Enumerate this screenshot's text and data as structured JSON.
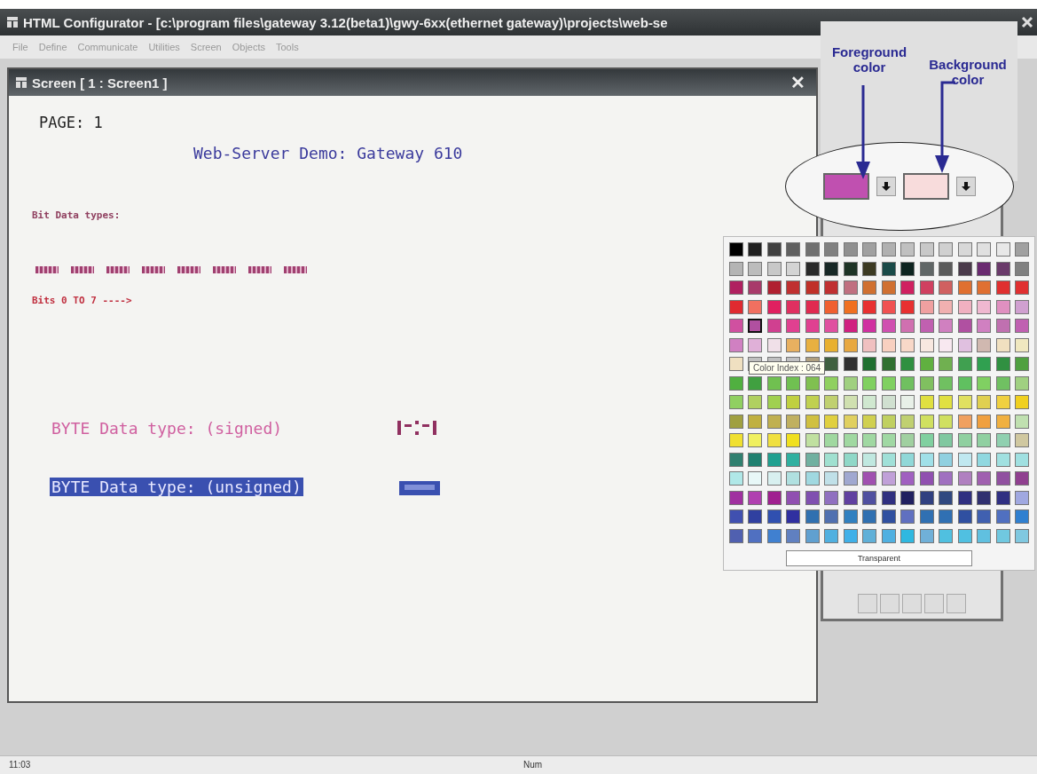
{
  "app_window": {
    "title": "HTML Configurator - [c:\\program files\\gateway 3.12(beta1)\\gwy-6xx(ethernet gateway)\\projects\\web-se"
  },
  "menu": [
    {
      "label": "File"
    },
    {
      "label": "Define"
    },
    {
      "label": "Communicate"
    },
    {
      "label": "Utilities"
    },
    {
      "label": "Screen"
    },
    {
      "label": "Objects"
    },
    {
      "label": "Tools"
    }
  ],
  "screen_window": {
    "title": "Screen [ 1 : Screen1 ]",
    "close": "✕"
  },
  "screen_objects": [
    {
      "kind": "text",
      "text": "PAGE: 1"
    },
    {
      "kind": "text",
      "text": "Web-Server Demo: Gateway 610"
    },
    {
      "kind": "text",
      "text": "Bit Data types:"
    },
    {
      "kind": "bits",
      "items": [
        {
          "kind": "bit"
        },
        {
          "kind": "bit"
        },
        {
          "kind": "bit"
        },
        {
          "kind": "bit"
        },
        {
          "kind": "bit"
        },
        {
          "kind": "bit"
        },
        {
          "kind": "bit"
        },
        {
          "kind": "bit"
        }
      ]
    },
    {
      "kind": "text",
      "text": "Bits 0 TO 7 ---->"
    },
    {
      "kind": "text",
      "text": "BYTE Data type: (signed)",
      "selected": false
    },
    {
      "kind": "value",
      "selected": false
    },
    {
      "kind": "text",
      "text": "BYTE Data type: (unsigned)",
      "selected": true
    },
    {
      "kind": "value",
      "selected": true
    }
  ],
  "palette": {
    "tooltip": "Color Index : 064",
    "transparent_button": "Transparent",
    "rows": [
      [
        {
          "color": "#000000",
          "selected": false
        },
        {
          "color": "#202020",
          "selected": false
        },
        {
          "color": "#404040",
          "selected": false
        },
        {
          "color": "#606060",
          "selected": false
        },
        {
          "color": "#707070",
          "selected": false
        },
        {
          "color": "#808080",
          "selected": false
        },
        {
          "color": "#909090",
          "selected": false
        },
        {
          "color": "#a0a0a0",
          "selected": false
        },
        {
          "color": "#b0b0b0",
          "selected": false
        },
        {
          "color": "#c0c0c0",
          "selected": false
        },
        {
          "color": "#c8c8c8",
          "selected": false
        },
        {
          "color": "#d0d0d0",
          "selected": false
        },
        {
          "color": "#d8d8d8",
          "selected": false
        },
        {
          "color": "#e0e0e0",
          "selected": false
        },
        {
          "color": "#e8e8e8",
          "selected": false
        },
        {
          "color": "#a0a0a0",
          "selected": false
        }
      ],
      [
        {
          "color": "#b4b4b4",
          "selected": false
        },
        {
          "color": "#bcbcbc",
          "selected": false
        },
        {
          "color": "#c8c8c8",
          "selected": false
        },
        {
          "color": "#d4d4d4",
          "selected": false
        },
        {
          "color": "#2a2a2a",
          "selected": false
        },
        {
          "color": "#182826",
          "selected": false
        },
        {
          "color": "#1e3426",
          "selected": false
        },
        {
          "color": "#3c3a22",
          "selected": false
        },
        {
          "color": "#1a4a48",
          "selected": false
        },
        {
          "color": "#0e2420",
          "selected": false
        },
        {
          "color": "#606666",
          "selected": false
        },
        {
          "color": "#5a5a5a",
          "selected": false
        },
        {
          "color": "#4a3a4a",
          "selected": false
        },
        {
          "color": "#6a2a70",
          "selected": false
        },
        {
          "color": "#6a3a6a",
          "selected": false
        },
        {
          "color": "#808080",
          "selected": false
        }
      ],
      [
        {
          "color": "#b02060",
          "selected": false
        },
        {
          "color": "#a83a6a",
          "selected": false
        },
        {
          "color": "#b02030",
          "selected": false
        },
        {
          "color": "#c03030",
          "selected": false
        },
        {
          "color": "#c03028",
          "selected": false
        },
        {
          "color": "#c03031",
          "selected": false
        },
        {
          "color": "#c07080",
          "selected": false
        },
        {
          "color": "#d07030",
          "selected": false
        },
        {
          "color": "#d07031",
          "selected": false
        },
        {
          "color": "#d02060",
          "selected": false
        },
        {
          "color": "#d04060",
          "selected": false
        },
        {
          "color": "#d06060",
          "selected": false
        },
        {
          "color": "#e07030",
          "selected": false
        },
        {
          "color": "#e07031",
          "selected": false
        },
        {
          "color": "#e03030",
          "selected": false
        },
        {
          "color": "#e03031",
          "selected": false
        }
      ],
      [
        {
          "color": "#e02a30",
          "selected": false
        },
        {
          "color": "#f07060",
          "selected": false
        },
        {
          "color": "#e02060",
          "selected": false
        },
        {
          "color": "#e03060",
          "selected": false
        },
        {
          "color": "#e02a50",
          "selected": false
        },
        {
          "color": "#f06030",
          "selected": false
        },
        {
          "color": "#f07020",
          "selected": false
        },
        {
          "color": "#e83030",
          "selected": false
        },
        {
          "color": "#f05050",
          "selected": false
        },
        {
          "color": "#e83031",
          "selected": false
        },
        {
          "color": "#f0a0a0",
          "selected": false
        },
        {
          "color": "#f0b0b0",
          "selected": false
        },
        {
          "color": "#f0b0c0",
          "selected": false
        },
        {
          "color": "#f0b8d0",
          "selected": false
        },
        {
          "color": "#e090c0",
          "selected": false
        },
        {
          "color": "#d0a0d0",
          "selected": false
        }
      ],
      [
        {
          "color": "#d050a0",
          "selected": false
        },
        {
          "color": "#b050a0",
          "selected": true
        },
        {
          "color": "#d04090",
          "selected": false
        },
        {
          "color": "#e04090",
          "selected": false
        },
        {
          "color": "#e04091",
          "selected": false
        },
        {
          "color": "#e050a0",
          "selected": false
        },
        {
          "color": "#d02080",
          "selected": false
        },
        {
          "color": "#d030a0",
          "selected": false
        },
        {
          "color": "#d050b0",
          "selected": false
        },
        {
          "color": "#d070b0",
          "selected": false
        },
        {
          "color": "#c060b0",
          "selected": false
        },
        {
          "color": "#d080c0",
          "selected": false
        },
        {
          "color": "#b050a1",
          "selected": false
        },
        {
          "color": "#d080c1",
          "selected": false
        },
        {
          "color": "#c070b0",
          "selected": false
        },
        {
          "color": "#c060b1",
          "selected": false
        }
      ],
      [
        {
          "color": "#d080c2",
          "selected": false
        },
        {
          "color": "#e0b0d8",
          "selected": false
        },
        {
          "color": "#f0e0e8",
          "selected": false
        },
        {
          "color": "#e8b060",
          "selected": false
        },
        {
          "color": "#e8b040",
          "selected": false
        },
        {
          "color": "#e8b030",
          "selected": false
        },
        {
          "color": "#e8a840",
          "selected": false
        },
        {
          "color": "#f0c0c0",
          "selected": false
        },
        {
          "color": "#f8d0c0",
          "selected": false
        },
        {
          "color": "#f8d8c8",
          "selected": false
        },
        {
          "color": "#f8e8e0",
          "selected": false
        },
        {
          "color": "#f8e8f0",
          "selected": false
        },
        {
          "color": "#e0c0e0",
          "selected": false
        },
        {
          "color": "#d0b8b0",
          "selected": false
        },
        {
          "color": "#f0e0c0",
          "selected": false
        },
        {
          "color": "#f0e8c0",
          "selected": false
        }
      ],
      [
        {
          "color": "#f0e0c1",
          "selected": false
        },
        {
          "color": "#c0c0c0",
          "selected": false
        },
        {
          "color": "#c0c0c1",
          "selected": false
        },
        {
          "color": "#c0c0c2",
          "selected": false
        },
        {
          "color": "#b0a080",
          "selected": false
        },
        {
          "color": "#406040",
          "selected": false
        },
        {
          "color": "#303030",
          "selected": false
        },
        {
          "color": "#207030",
          "selected": false
        },
        {
          "color": "#307030",
          "selected": false
        },
        {
          "color": "#309040",
          "selected": false
        },
        {
          "color": "#60b040",
          "selected": false
        },
        {
          "color": "#70b050",
          "selected": false
        },
        {
          "color": "#40a050",
          "selected": false
        },
        {
          "color": "#30a050",
          "selected": false
        },
        {
          "color": "#309041",
          "selected": false
        },
        {
          "color": "#50a040",
          "selected": false
        }
      ],
      [
        {
          "color": "#50b040",
          "selected": false
        },
        {
          "color": "#40a040",
          "selected": false
        },
        {
          "color": "#70c050",
          "selected": false
        },
        {
          "color": "#70c051",
          "selected": false
        },
        {
          "color": "#80c050",
          "selected": false
        },
        {
          "color": "#90d060",
          "selected": false
        },
        {
          "color": "#a0d080",
          "selected": false
        },
        {
          "color": "#80d060",
          "selected": false
        },
        {
          "color": "#80d061",
          "selected": false
        },
        {
          "color": "#70c060",
          "selected": false
        },
        {
          "color": "#80c060",
          "selected": false
        },
        {
          "color": "#70c061",
          "selected": false
        },
        {
          "color": "#60c060",
          "selected": false
        },
        {
          "color": "#80d062",
          "selected": false
        },
        {
          "color": "#70c062",
          "selected": false
        },
        {
          "color": "#a0d081",
          "selected": false
        }
      ],
      [
        {
          "color": "#90d061",
          "selected": false
        },
        {
          "color": "#b0d060",
          "selected": false
        },
        {
          "color": "#a0d050",
          "selected": false
        },
        {
          "color": "#c0d040",
          "selected": false
        },
        {
          "color": "#c0d050",
          "selected": false
        },
        {
          "color": "#c0d070",
          "selected": false
        },
        {
          "color": "#d0e0b0",
          "selected": false
        },
        {
          "color": "#d0e8d0",
          "selected": false
        },
        {
          "color": "#d0e0d0",
          "selected": false
        },
        {
          "color": "#e8f0e8",
          "selected": false
        },
        {
          "color": "#e0e040",
          "selected": false
        },
        {
          "color": "#e0e041",
          "selected": false
        },
        {
          "color": "#e0e060",
          "selected": false
        },
        {
          "color": "#e0d050",
          "selected": false
        },
        {
          "color": "#f0d040",
          "selected": false
        },
        {
          "color": "#f0d020",
          "selected": false
        }
      ],
      [
        {
          "color": "#a0a040",
          "selected": false
        },
        {
          "color": "#c0b040",
          "selected": false
        },
        {
          "color": "#c0b050",
          "selected": false
        },
        {
          "color": "#c0b060",
          "selected": false
        },
        {
          "color": "#d0c040",
          "selected": false
        },
        {
          "color": "#e0d040",
          "selected": false
        },
        {
          "color": "#e0d060",
          "selected": false
        },
        {
          "color": "#d0d050",
          "selected": false
        },
        {
          "color": "#c0d060",
          "selected": false
        },
        {
          "color": "#c0d071",
          "selected": false
        },
        {
          "color": "#d0e060",
          "selected": false
        },
        {
          "color": "#d0e061",
          "selected": false
        },
        {
          "color": "#f0a060",
          "selected": false
        },
        {
          "color": "#f0a040",
          "selected": false
        },
        {
          "color": "#f0b040",
          "selected": false
        },
        {
          "color": "#c0e0b0",
          "selected": false
        }
      ],
      [
        {
          "color": "#f0e030",
          "selected": false
        },
        {
          "color": "#f0f060",
          "selected": false
        },
        {
          "color": "#f0e040",
          "selected": false
        },
        {
          "color": "#f0e020",
          "selected": false
        },
        {
          "color": "#c0e0a0",
          "selected": false
        },
        {
          "color": "#a0d8a0",
          "selected": false
        },
        {
          "color": "#a0d8a1",
          "selected": false
        },
        {
          "color": "#a0d8a2",
          "selected": false
        },
        {
          "color": "#a0d8a3",
          "selected": false
        },
        {
          "color": "#a0d0a0",
          "selected": false
        },
        {
          "color": "#80d0a0",
          "selected": false
        },
        {
          "color": "#80c8a0",
          "selected": false
        },
        {
          "color": "#90d0a0",
          "selected": false
        },
        {
          "color": "#90d0a1",
          "selected": false
        },
        {
          "color": "#90d0b0",
          "selected": false
        },
        {
          "color": "#d0c8a0",
          "selected": false
        }
      ],
      [
        {
          "color": "#308070",
          "selected": false
        },
        {
          "color": "#208070",
          "selected": false
        },
        {
          "color": "#20a090",
          "selected": false
        },
        {
          "color": "#30b0a0",
          "selected": false
        },
        {
          "color": "#70b0a0",
          "selected": false
        },
        {
          "color": "#a0e0d0",
          "selected": false
        },
        {
          "color": "#90d8c8",
          "selected": false
        },
        {
          "color": "#c0e8e0",
          "selected": false
        },
        {
          "color": "#a0e0d8",
          "selected": false
        },
        {
          "color": "#90d8d8",
          "selected": false
        },
        {
          "color": "#a0e0e8",
          "selected": false
        },
        {
          "color": "#90d0e0",
          "selected": false
        },
        {
          "color": "#c0e8f0",
          "selected": false
        },
        {
          "color": "#90d8e0",
          "selected": false
        },
        {
          "color": "#a0e0e0",
          "selected": false
        },
        {
          "color": "#a0e0e1",
          "selected": false
        }
      ],
      [
        {
          "color": "#b0e8e8",
          "selected": false
        },
        {
          "color": "#e8f8f8",
          "selected": false
        },
        {
          "color": "#d8f0f0",
          "selected": false
        },
        {
          "color": "#b0e0e0",
          "selected": false
        },
        {
          "color": "#a0d8e0",
          "selected": false
        },
        {
          "color": "#c0e0e8",
          "selected": false
        },
        {
          "color": "#a0a8d0",
          "selected": false
        },
        {
          "color": "#a050b0",
          "selected": false
        },
        {
          "color": "#c0a0d8",
          "selected": false
        },
        {
          "color": "#a060c0",
          "selected": false
        },
        {
          "color": "#9050b0",
          "selected": false
        },
        {
          "color": "#a070c0",
          "selected": false
        },
        {
          "color": "#b080c0",
          "selected": false
        },
        {
          "color": "#a060b0",
          "selected": false
        },
        {
          "color": "#9050a0",
          "selected": false
        },
        {
          "color": "#904090",
          "selected": false
        }
      ],
      [
        {
          "color": "#a030a0",
          "selected": false
        },
        {
          "color": "#b040b0",
          "selected": false
        },
        {
          "color": "#a02090",
          "selected": false
        },
        {
          "color": "#9050b1",
          "selected": false
        },
        {
          "color": "#8050b0",
          "selected": false
        },
        {
          "color": "#9070c0",
          "selected": false
        },
        {
          "color": "#6040a0",
          "selected": false
        },
        {
          "color": "#5050a0",
          "selected": false
        },
        {
          "color": "#303080",
          "selected": false
        },
        {
          "color": "#202060",
          "selected": false
        },
        {
          "color": "#304080",
          "selected": false
        },
        {
          "color": "#304880",
          "selected": false
        },
        {
          "color": "#303081",
          "selected": false
        },
        {
          "color": "#303070",
          "selected": false
        },
        {
          "color": "#303082",
          "selected": false
        },
        {
          "color": "#a0a8e0",
          "selected": false
        }
      ],
      [
        {
          "color": "#4050b0",
          "selected": false
        },
        {
          "color": "#3040a0",
          "selected": false
        },
        {
          "color": "#3050b0",
          "selected": false
        },
        {
          "color": "#3030a0",
          "selected": false
        },
        {
          "color": "#3070b0",
          "selected": false
        },
        {
          "color": "#5070b0",
          "selected": false
        },
        {
          "color": "#3080c0",
          "selected": false
        },
        {
          "color": "#3070b1",
          "selected": false
        },
        {
          "color": "#3050a0",
          "selected": false
        },
        {
          "color": "#6070c0",
          "selected": false
        },
        {
          "color": "#3070b2",
          "selected": false
        },
        {
          "color": "#3070b3",
          "selected": false
        },
        {
          "color": "#3050a1",
          "selected": false
        },
        {
          "color": "#4060b0",
          "selected": false
        },
        {
          "color": "#5070c0",
          "selected": false
        },
        {
          "color": "#3080d0",
          "selected": false
        }
      ],
      [
        {
          "color": "#5060b0",
          "selected": false
        },
        {
          "color": "#5070c1",
          "selected": false
        },
        {
          "color": "#4080d0",
          "selected": false
        },
        {
          "color": "#6080c0",
          "selected": false
        },
        {
          "color": "#60a0d0",
          "selected": false
        },
        {
          "color": "#50b0e0",
          "selected": false
        },
        {
          "color": "#40b0e8",
          "selected": false
        },
        {
          "color": "#60b0d8",
          "selected": false
        },
        {
          "color": "#50b0e1",
          "selected": false
        },
        {
          "color": "#30b8e0",
          "selected": false
        },
        {
          "color": "#70b0d8",
          "selected": false
        },
        {
          "color": "#50c0e0",
          "selected": false
        },
        {
          "color": "#50c0e1",
          "selected": false
        },
        {
          "color": "#60c0e0",
          "selected": false
        },
        {
          "color": "#70c8e0",
          "selected": false
        },
        {
          "color": "#80c8e0",
          "selected": false
        }
      ]
    ]
  },
  "callout": {
    "foreground_label": "Foreground color",
    "background_label": "Background color",
    "color_boxes": [
      {
        "color": "#c050b0"
      },
      {
        "color": "#f8dcdc"
      }
    ]
  },
  "status_bar": {
    "time": "11:03",
    "num": "Num"
  }
}
